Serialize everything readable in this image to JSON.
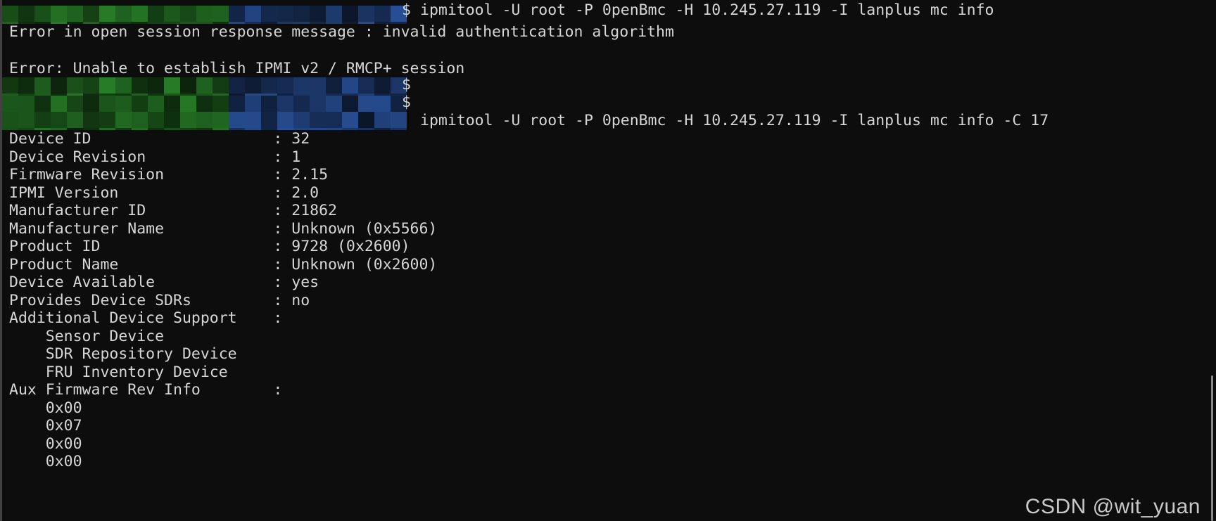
{
  "terminal": {
    "background_color": "#0d0d0d",
    "text_color": "#d6d6d6",
    "redaction_green": "#1d5c1d",
    "redaction_blue": "#1d3a6e",
    "prompt_symbol": "$",
    "key_column_width": 29
  },
  "session": {
    "commands": [
      {
        "prompt_redacted": true,
        "text": "ipmitool -U root -P 0penBmc -H 10.245.27.119 -I lanplus mc info"
      },
      {
        "prompt_redacted": true,
        "text": "ipmitool -U root -P 0penBmc -H 10.245.27.119 -I lanplus mc info -C 17"
      }
    ],
    "error_lines": [
      "Error in open session response message : invalid authentication algorithm",
      "Error: Unable to establish IPMI v2 / RMCP+ session"
    ],
    "mc_info": {
      "rows": [
        {
          "key": "Device ID",
          "value": "32"
        },
        {
          "key": "Device Revision",
          "value": "1"
        },
        {
          "key": "Firmware Revision",
          "value": "2.15"
        },
        {
          "key": "IPMI Version",
          "value": "2.0"
        },
        {
          "key": "Manufacturer ID",
          "value": "21862"
        },
        {
          "key": "Manufacturer Name",
          "value": "Unknown (0x5566)"
        },
        {
          "key": "Product ID",
          "value": "9728 (0x2600)"
        },
        {
          "key": "Product Name",
          "value": "Unknown (0x2600)"
        },
        {
          "key": "Device Available",
          "value": "yes"
        },
        {
          "key": "Provides Device SDRs",
          "value": "no"
        },
        {
          "key": "Additional Device Support",
          "value": ""
        }
      ],
      "additional_device_support": [
        "Sensor Device",
        "SDR Repository Device",
        "FRU Inventory Device"
      ],
      "aux_firmware_rev_label": "Aux Firmware Rev Info",
      "aux_firmware_rev_info": [
        "0x00",
        "0x07",
        "0x00",
        "0x00"
      ]
    }
  },
  "watermark": {
    "text": "CSDN @wit_yuan"
  }
}
